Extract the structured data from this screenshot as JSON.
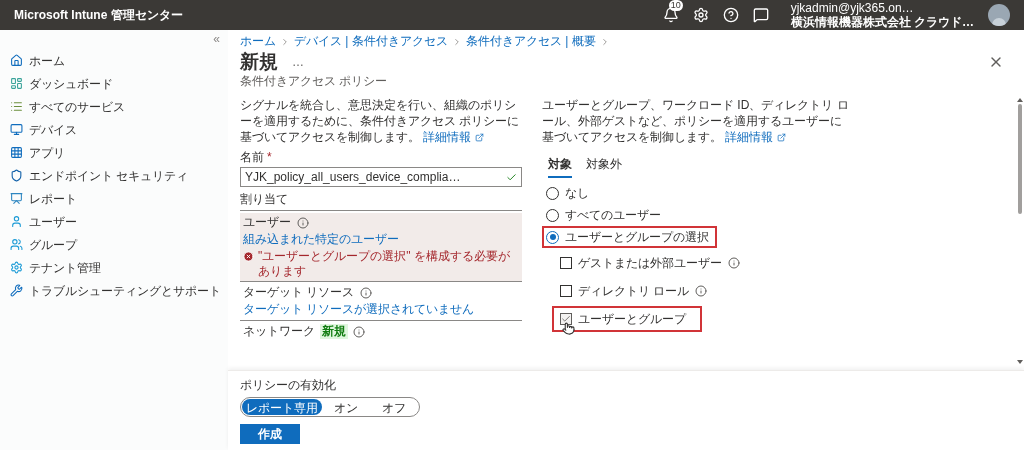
{
  "header": {
    "title": "Microsoft Intune 管理センター",
    "notification_count": "10",
    "user_email": "yjkadmin@yjk365.on…",
    "user_org": "横浜情報機器株式会社 クラウド…"
  },
  "sidebar": {
    "collapse": "«",
    "items": [
      {
        "label": "ホーム"
      },
      {
        "label": "ダッシュボード"
      },
      {
        "label": "すべてのサービス"
      },
      {
        "label": "デバイス"
      },
      {
        "label": "アプリ"
      },
      {
        "label": "エンドポイント セキュリティ"
      },
      {
        "label": "レポート"
      },
      {
        "label": "ユーザー"
      },
      {
        "label": "グループ"
      },
      {
        "label": "テナント管理"
      },
      {
        "label": "トラブルシューティングとサポート"
      }
    ]
  },
  "breadcrumb": [
    "ホーム",
    "デバイス | 条件付きアクセス",
    "条件付きアクセス | 概要"
  ],
  "page": {
    "title": "新規",
    "more": "…",
    "subtitle": "条件付きアクセス ポリシー"
  },
  "left": {
    "description": "シグナルを統合し、意思決定を行い、組織のポリシーを適用するために、条件付きアクセス ポリシーに基づいてアクセスを制御します。",
    "link": "詳細情報",
    "name_label": "名前",
    "required_mark": "*",
    "name_value": "YJK_policy_all_users_device_complia…",
    "assignments_heading": "割り当て",
    "users": {
      "label": "ユーザー",
      "value": "組み込まれた特定のユーザー",
      "error": "\"ユーザーとグループの選択\" を構成する必要があります"
    },
    "target_resources": {
      "label": "ターゲット リソース",
      "value": "ターゲット リソースが選択されていません"
    },
    "network": {
      "label": "ネットワーク",
      "badge": "新規"
    }
  },
  "right": {
    "description": "ユーザーとグループ、ワークロード ID、ディレクトリ ロール、外部ゲストなど、ポリシーを適用するユーザーに基づいてアクセスを制御します。",
    "link": "詳細情報",
    "tabs": [
      {
        "label": "対象",
        "selected": true
      },
      {
        "label": "対象外",
        "selected": false
      }
    ],
    "radios": [
      {
        "label": "なし",
        "selected": false,
        "highlighted": false
      },
      {
        "label": "すべてのユーザー",
        "selected": false,
        "highlighted": false
      },
      {
        "label": "ユーザーとグループの選択",
        "selected": true,
        "highlighted": true
      }
    ],
    "checkboxes": [
      {
        "label": "ゲストまたは外部ユーザー",
        "checked": false,
        "info": true,
        "highlighted": false
      },
      {
        "label": "ディレクトリ ロール",
        "checked": false,
        "info": true,
        "highlighted": false
      },
      {
        "label": "ユーザーとグループ",
        "checked": true,
        "info": false,
        "highlighted": true
      }
    ]
  },
  "footer": {
    "label": "ポリシーの有効化",
    "toggle": [
      {
        "label": "レポート専用",
        "selected": true
      },
      {
        "label": "オン",
        "selected": false
      },
      {
        "label": "オフ",
        "selected": false
      }
    ],
    "create_button": "作成"
  }
}
